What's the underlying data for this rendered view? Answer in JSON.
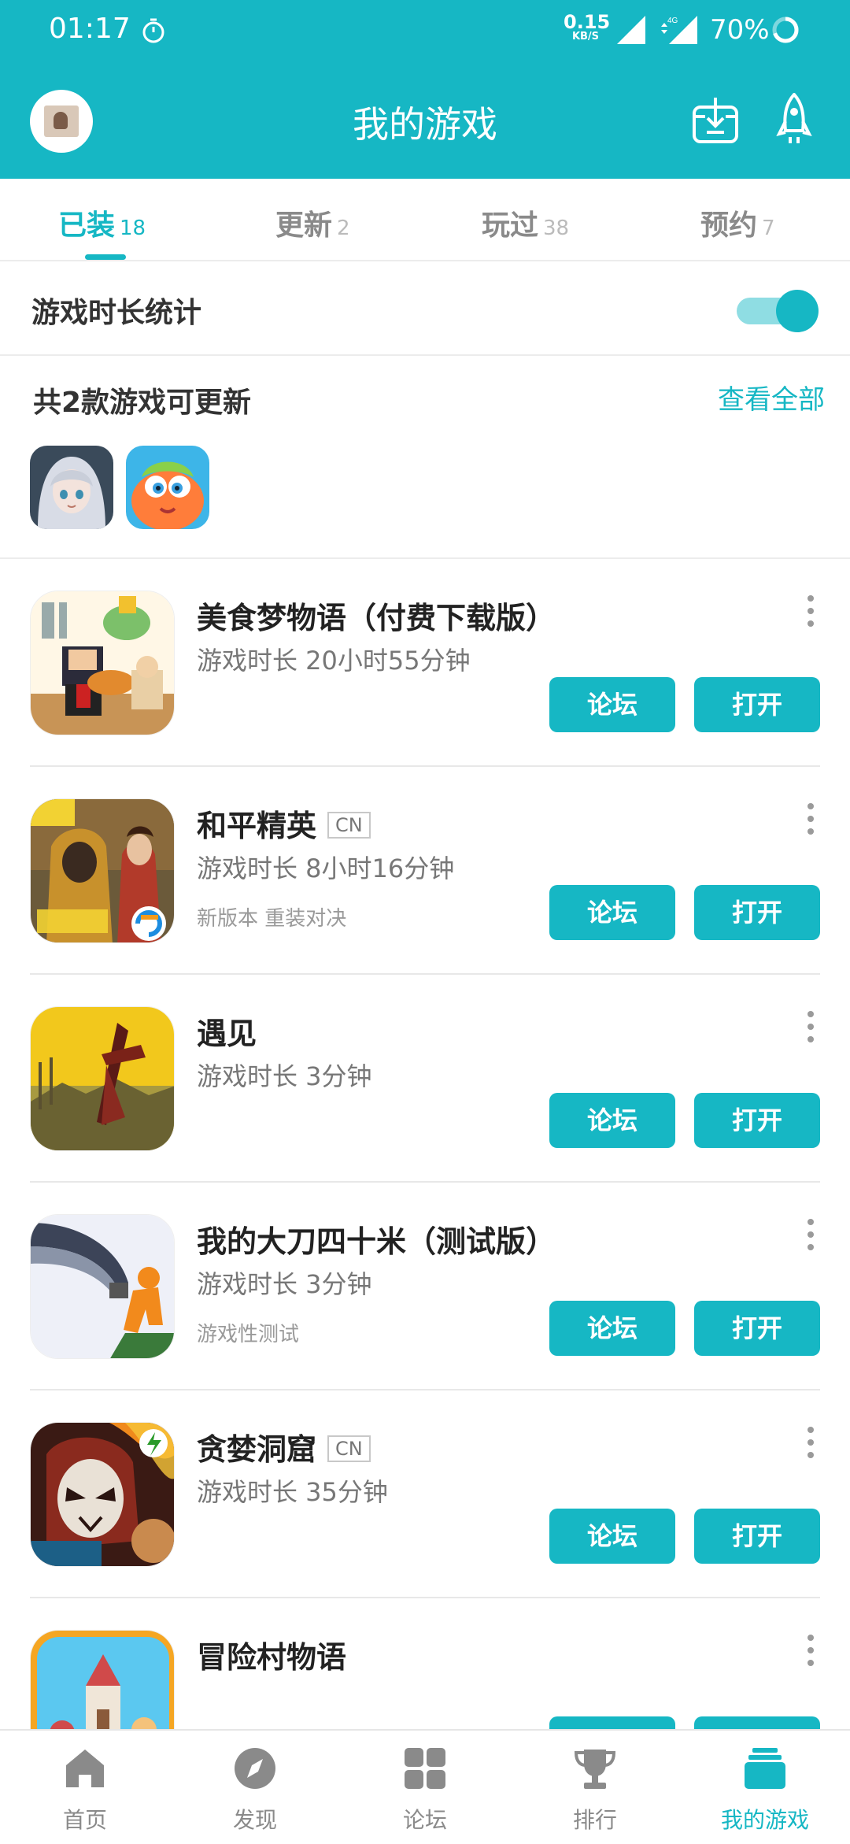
{
  "status_bar": {
    "time": "01:17",
    "net_speed": "0.15",
    "net_speed_unit": "KB/S",
    "network_type": "4G",
    "battery": "70%",
    "icons": [
      "timer-icon",
      "signal-icon",
      "signal-4g-icon",
      "battery-ring-icon"
    ]
  },
  "header": {
    "title": "我的游戏",
    "icons": [
      "avatar",
      "download-icon",
      "rocket-icon"
    ]
  },
  "tabs": [
    {
      "label": "已装",
      "count": "18",
      "active": true
    },
    {
      "label": "更新",
      "count": "2",
      "active": false
    },
    {
      "label": "玩过",
      "count": "38",
      "active": false
    },
    {
      "label": "预约",
      "count": "7",
      "active": false
    }
  ],
  "stats": {
    "label": "游戏时长统计",
    "enabled": true
  },
  "updates": {
    "title": "共2款游戏可更新",
    "view_all": "查看全部"
  },
  "games": [
    {
      "name": "美食梦物语（付费下载版）",
      "tag": "",
      "time": "游戏时长 20小时55分钟",
      "note": ""
    },
    {
      "name": "和平精英",
      "tag": "CN",
      "time": "游戏时长 8小时16分钟",
      "note": "新版本 重装对决"
    },
    {
      "name": "遇见",
      "tag": "",
      "time": "游戏时长 3分钟",
      "note": ""
    },
    {
      "name": "我的大刀四十米（测试版）",
      "tag": "",
      "time": "游戏时长 3分钟",
      "note": "游戏性测试"
    },
    {
      "name": "贪婪洞窟",
      "tag": "CN",
      "time": "游戏时长 35分钟",
      "note": ""
    },
    {
      "name": "冒险村物语",
      "tag": "",
      "time": "",
      "note": ""
    }
  ],
  "buttons": {
    "forum": "论坛",
    "open": "打开"
  },
  "bottom_nav": [
    {
      "label": "首页",
      "icon": "home-icon",
      "active": false
    },
    {
      "label": "发现",
      "icon": "compass-icon",
      "active": false
    },
    {
      "label": "论坛",
      "icon": "grid-icon",
      "active": false
    },
    {
      "label": "排行",
      "icon": "trophy-icon",
      "active": false
    },
    {
      "label": "我的游戏",
      "icon": "game-stack-icon",
      "active": true
    }
  ],
  "colors": {
    "accent": "#16b7c4",
    "accent_light": "#8fdde3"
  }
}
